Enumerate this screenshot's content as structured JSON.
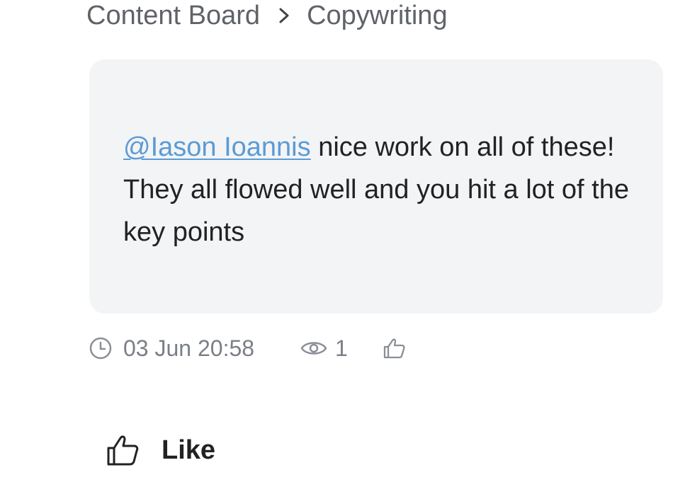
{
  "breadcrumb": {
    "items": [
      {
        "label": "Content Board"
      },
      {
        "label": "Copywriting"
      }
    ],
    "separator_icon": "chevron-right-icon"
  },
  "comment": {
    "mention": "@Iason Ioannis",
    "text": " nice work on all of these! They all flowed well and you hit a lot of the key points"
  },
  "meta": {
    "timestamp": "03 Jun 20:58",
    "views": "1",
    "clock_icon": "clock-icon",
    "views_icon": "eye-icon",
    "like_icon": "thumbs-up-icon"
  },
  "actions": {
    "like_label": "Like"
  },
  "colors": {
    "mention": "#5b9bd5",
    "card_bg": "#f3f4f6",
    "muted": "#7a7f87"
  }
}
